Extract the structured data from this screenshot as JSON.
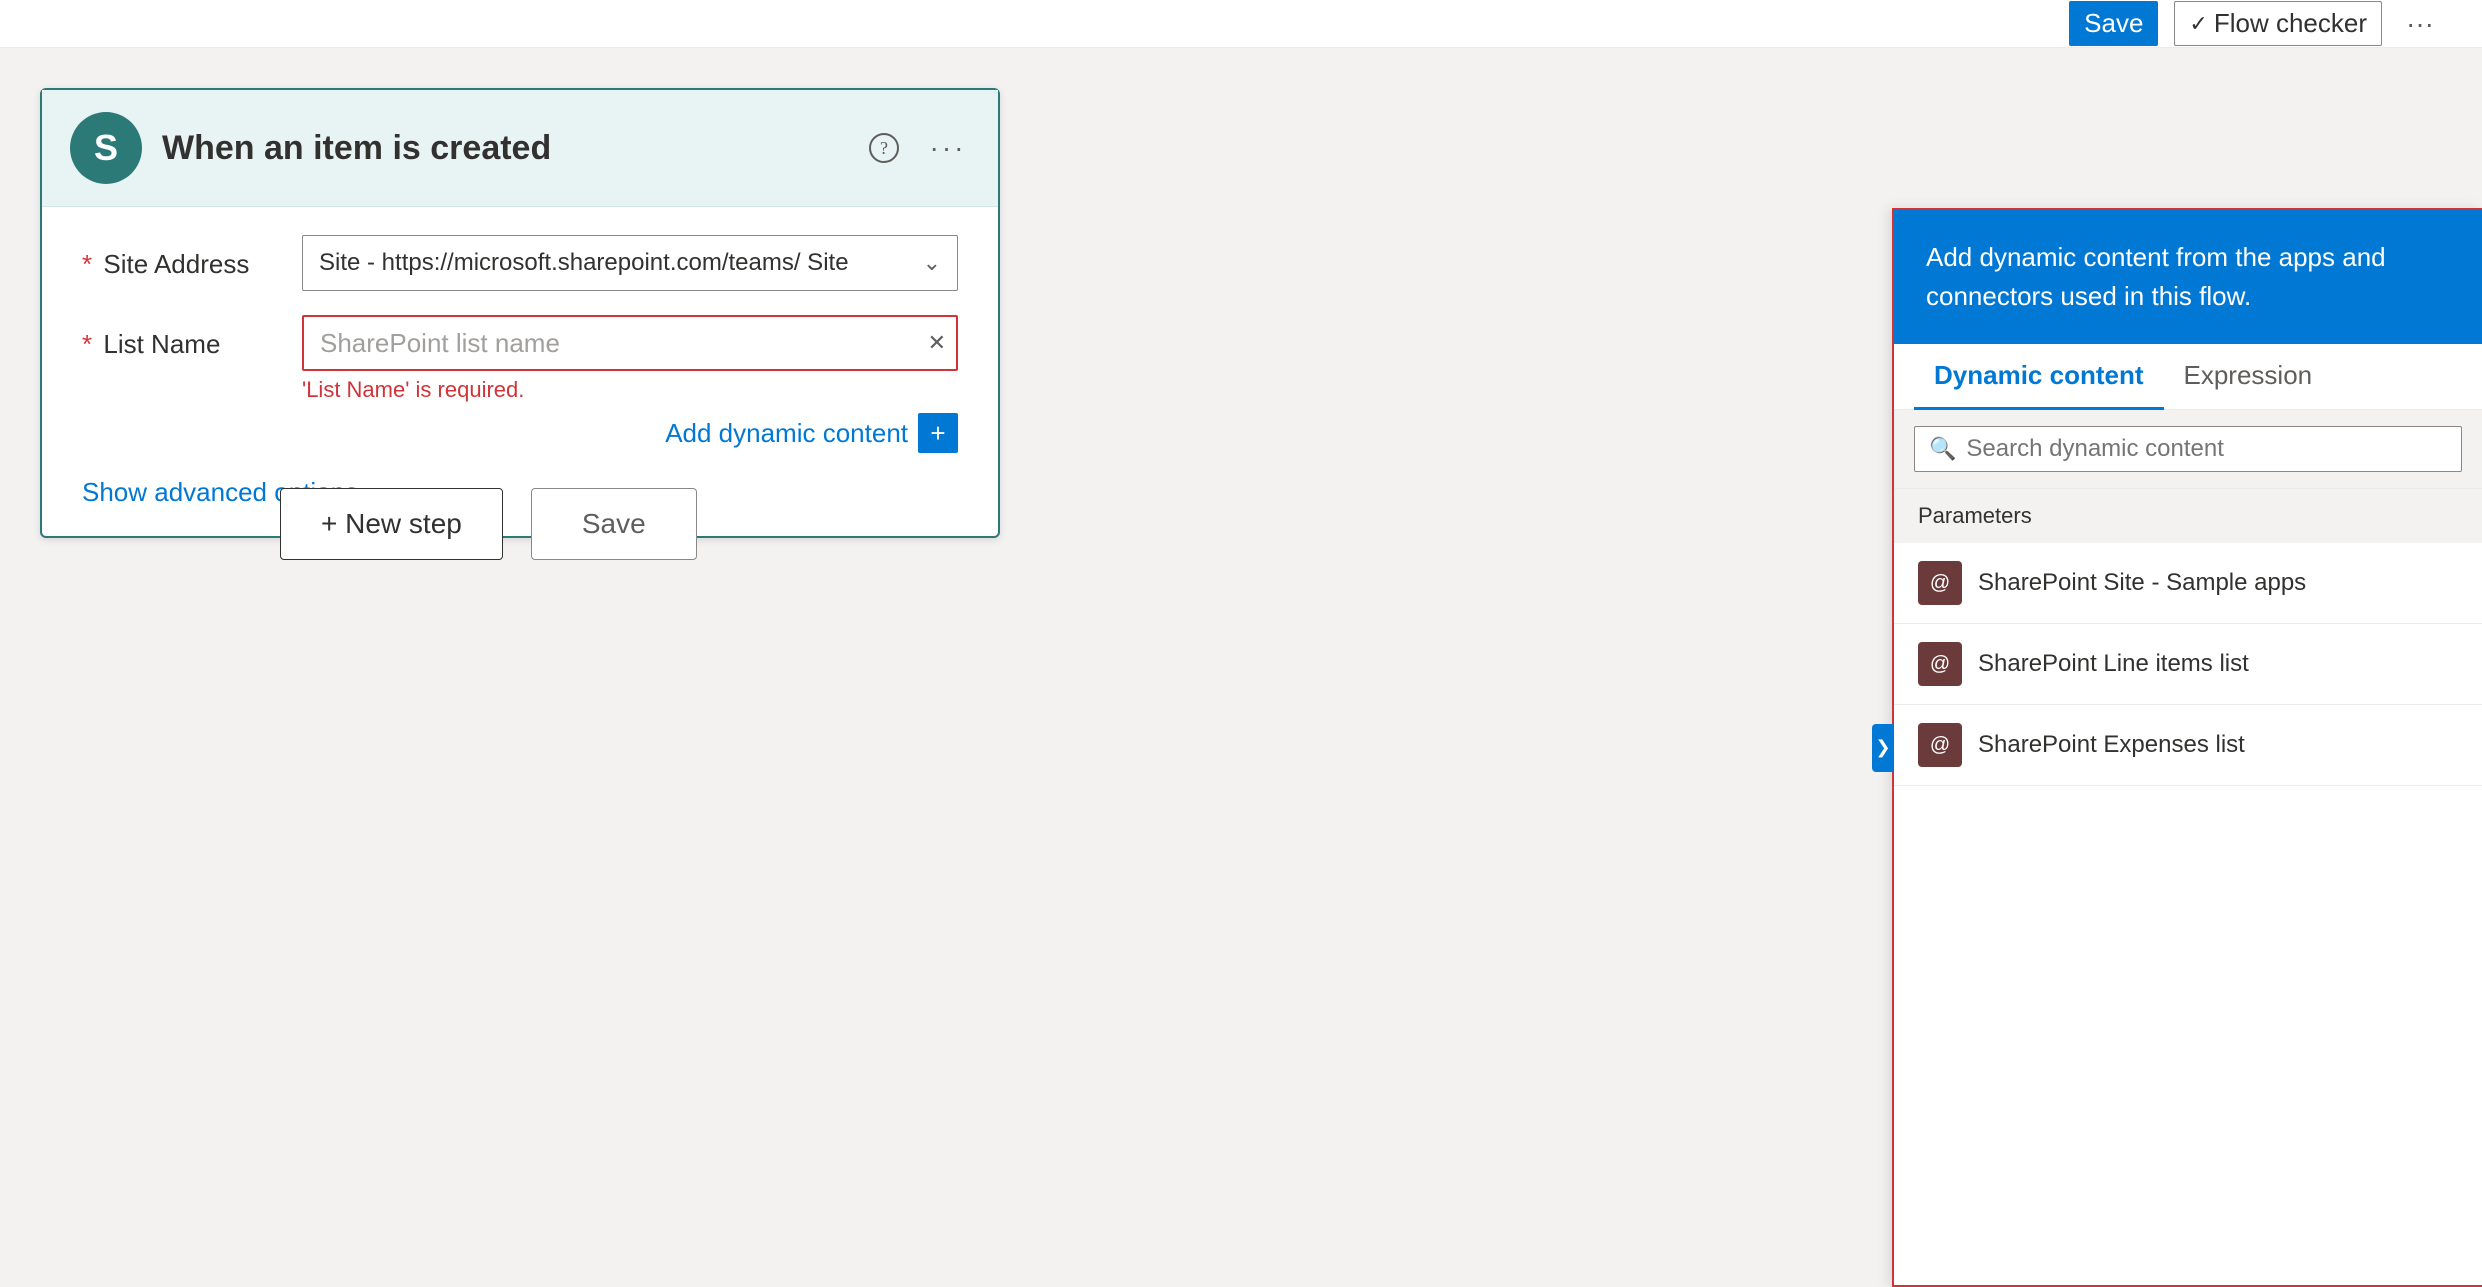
{
  "topbar": {
    "save_label": "Save",
    "flow_checker_label": "Flow checker",
    "more_label": "···"
  },
  "flow_card": {
    "icon_letter": "S",
    "title": "When an item is created",
    "help_icon": "?",
    "more_icon": "···",
    "site_address_label": "Site Address",
    "site_address_value": "Site - https://microsoft.sharepoint.com/teams/  Site",
    "list_name_label": "List Name",
    "list_name_placeholder": "SharePoint list name",
    "list_name_error": "'List Name' is required.",
    "add_dynamic_content_label": "Add dynamic content",
    "show_advanced_label": "Show advanced options"
  },
  "action_buttons": {
    "new_step_label": "+ New step",
    "save_label": "Save"
  },
  "dynamic_panel": {
    "header_text": "Add dynamic content from the apps and connectors used in this flow.",
    "tab_dynamic": "Dynamic content",
    "tab_expression": "Expression",
    "search_placeholder": "Search dynamic content",
    "section_label": "Parameters",
    "items": [
      {
        "label": "SharePoint Site - Sample apps",
        "icon": "@"
      },
      {
        "label": "SharePoint Line items list",
        "icon": "@"
      },
      {
        "label": "SharePoint Expenses list",
        "icon": "@"
      }
    ]
  }
}
